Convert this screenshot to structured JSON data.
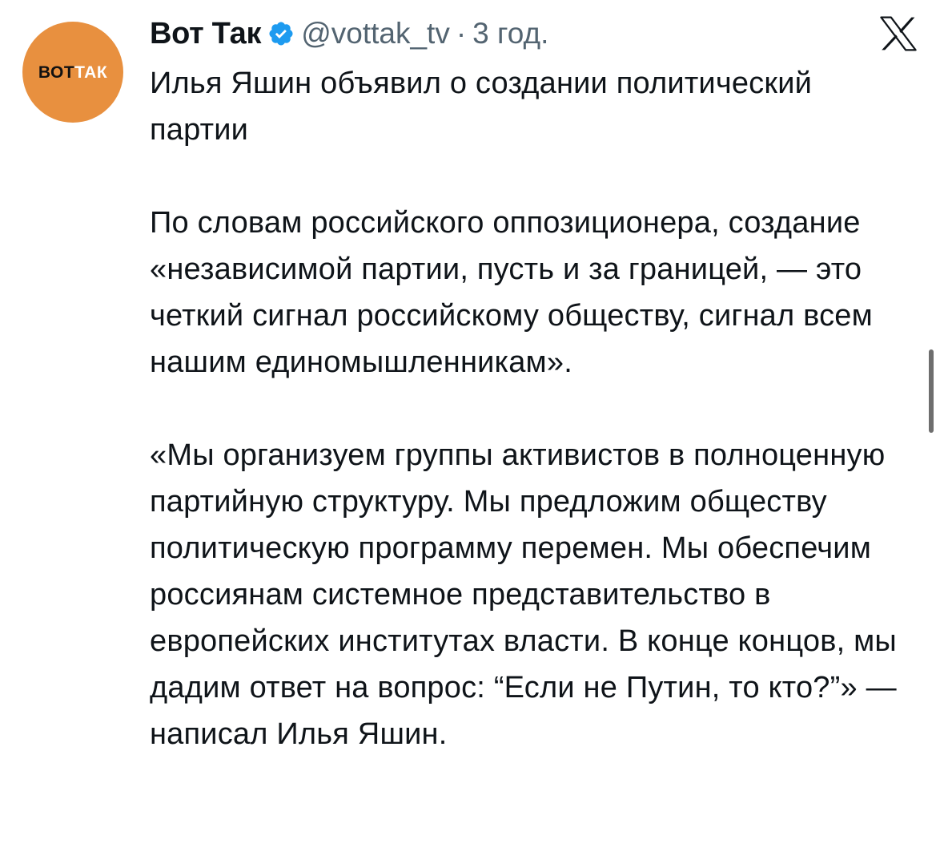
{
  "account": {
    "display_name": "Вот Так",
    "handle": "@vottak_tv",
    "separator": "·",
    "time": "3 год.",
    "verified": true,
    "avatar": {
      "logo_part1": "ВОТ",
      "logo_part2": "ТАК",
      "color": "#e8903f"
    }
  },
  "platform_icon": "x-logo-icon",
  "tweet": {
    "text": "Илья Яшин объявил о создании политический партии\n\nПо словам российского оппозиционера, создание «независимой партии, пусть и за границей, — это четкий сигнал российскому обществу, сигнал всем нашим единомышленникам».\n\n«Мы организуем группы активистов в полноценную партийную структуру. Мы предложим обществу политическую программу перемен. Мы обеспечим россиянам системное представительство в европейских институтах власти. В конце концов, мы дадим ответ на вопрос: “Если не Путин, то кто?”» — написал Илья Яшин."
  },
  "colors": {
    "text_primary": "#0f1419",
    "text_secondary": "#536471",
    "verified_badge": "#1d9bf0"
  }
}
